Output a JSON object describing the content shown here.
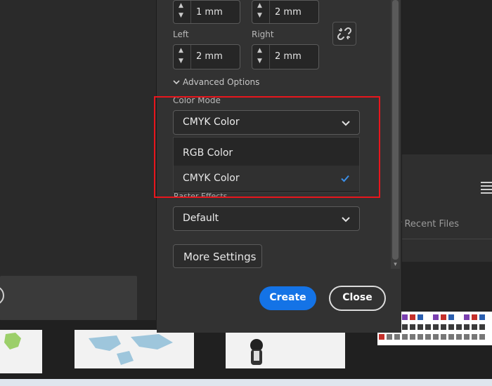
{
  "margins": {
    "left_label": "Left",
    "right_label": "Right",
    "top_value": "1 mm",
    "bottom_value": "2 mm",
    "left_value": "2 mm",
    "right_value": "2 mm"
  },
  "advanced_options": {
    "label": "Advanced Options"
  },
  "color_mode": {
    "label": "Color Mode",
    "selected": "CMYK Color",
    "options": [
      {
        "label": "RGB Color",
        "selected": false
      },
      {
        "label": "CMYK Color",
        "selected": true
      }
    ]
  },
  "raster_effects": {
    "label": "Raster Effects",
    "value": "Default"
  },
  "buttons": {
    "more_settings": "More Settings",
    "create": "Create",
    "close": "Close"
  },
  "background": {
    "recent_files": "r Recent Files"
  },
  "colors": {
    "accent": "#1473e6",
    "highlight": "#e8161d",
    "dialog_bg": "#323232",
    "checkmark": "#3b8fe8"
  }
}
